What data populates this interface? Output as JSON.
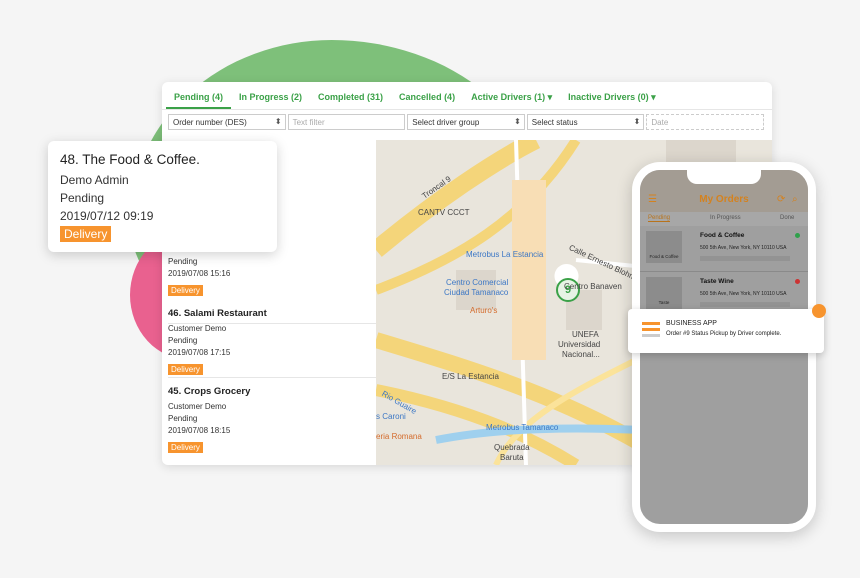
{
  "tabs": [
    {
      "label": "Pending (4)"
    },
    {
      "label": "In Progress (2)"
    },
    {
      "label": "Completed (31)"
    },
    {
      "label": "Cancelled (4)"
    },
    {
      "label": "Active Drivers (1) ▾"
    },
    {
      "label": "Inactive Drivers (0) ▾"
    }
  ],
  "filters": {
    "order_sort": "Order number (DES)",
    "text_filter_placeholder": "Text filter",
    "driver_group": "Select driver group",
    "status": "Select status",
    "date_placeholder": "Date"
  },
  "orders": [
    {
      "name": "",
      "customer": "",
      "status": "Pending",
      "datetime": "2019/07/08 15:16",
      "badge": "Delivery"
    },
    {
      "name": "46. Salami Restaurant",
      "customer": "Customer Demo",
      "status": "Pending",
      "datetime": "2019/07/08 17:15",
      "badge": "Delivery"
    },
    {
      "name": "45. Crops Grocery",
      "customer": "Customer Demo",
      "status": "Pending",
      "datetime": "2019/07/08 18:15",
      "badge": "Delivery"
    }
  ],
  "popup_card": {
    "title": "48. The Food & Coffee.",
    "customer": "Demo Admin",
    "status": "Pending",
    "datetime": "2019/07/12 09:19",
    "badge": "Delivery"
  },
  "map_labels": {
    "troncal": "Troncal 9",
    "cantv": "CANTV CCCT",
    "metrobus_estancia": "Metrobus La Estancia",
    "ernesto": "Calle Ernesto Blohm",
    "centro_comercial_1": "Centro Comercial",
    "centro_comercial_2": "Ciudad Tamanaco",
    "banaven": "Centro Banaven",
    "arturos": "Arturo's",
    "unefa_1": "UNEFA",
    "unefa_2": "Universidad",
    "unefa_3": "Nacional...",
    "es_estancia": "E/S La Estancia",
    "rio_guaire": "Rio Guaire",
    "caroni": "s Caroni",
    "romana": "eria Romana",
    "metrobus_tamanaco": "Metrobus Tamanaco",
    "quebrada_1": "Quebrada",
    "quebrada_2": "Baruta",
    "driver_pin": "9"
  },
  "phone": {
    "title": "My Orders",
    "tabs": [
      "Pending",
      "In Progress",
      "Done"
    ],
    "items": [
      {
        "name": "Food & Coffee",
        "address": "500 5th Ave, New York, NY 10110 USA",
        "logo": "Food & Coffee"
      },
      {
        "name": "Taste Wine",
        "address": "500 5th Ave, New York, NY 10110 USA",
        "logo": "Taste"
      }
    ]
  },
  "notification": {
    "title": "BUSINESS APP",
    "message": "Order #9 Status Pickup by Driver complete."
  },
  "colors": {
    "accent_green": "#3ba148",
    "badge_orange": "#f7942e",
    "phone_title": "#d4821f"
  }
}
